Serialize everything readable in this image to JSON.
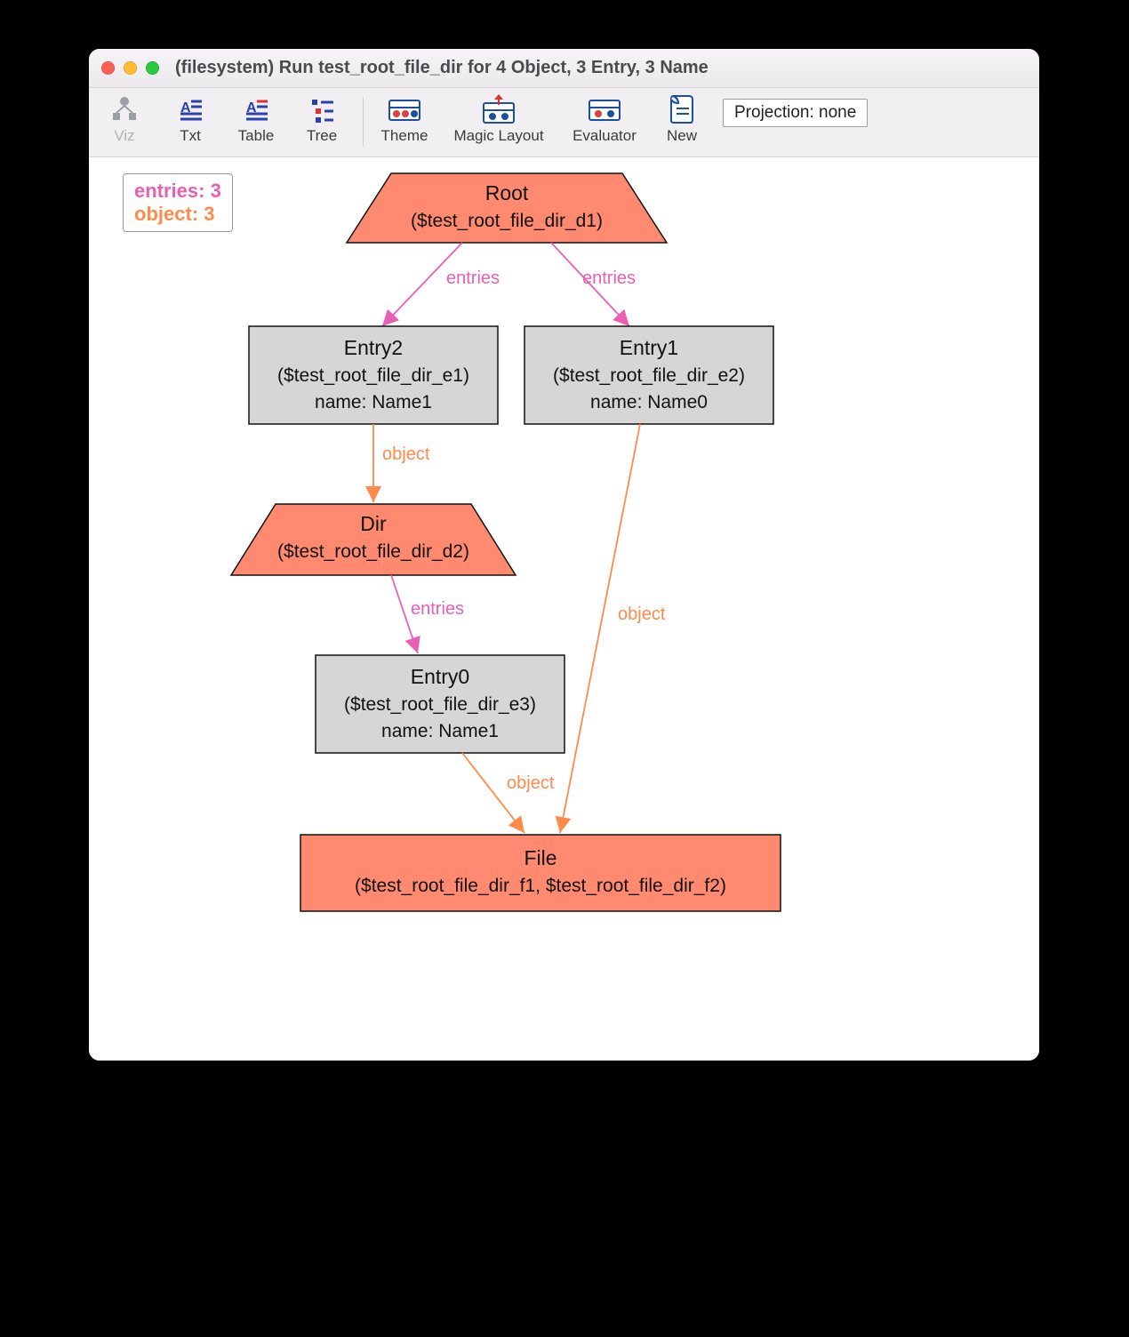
{
  "window": {
    "title": "(filesystem) Run test_root_file_dir for 4 Object, 3 Entry, 3 Name"
  },
  "toolbar": {
    "viz": "Viz",
    "txt": "Txt",
    "table": "Table",
    "tree": "Tree",
    "theme": "Theme",
    "magic": "Magic Layout",
    "eval": "Evaluator",
    "new": "New",
    "projection": "Projection: none"
  },
  "legend": {
    "entries": "entries: 3",
    "object": "object: 3"
  },
  "graph": {
    "nodes": {
      "root": {
        "title": "Root",
        "sub": "($test_root_file_dir_d1)"
      },
      "entry2": {
        "title": "Entry2",
        "sub": "($test_root_file_dir_e1)",
        "attr": "name: Name1"
      },
      "entry1": {
        "title": "Entry1",
        "sub": "($test_root_file_dir_e2)",
        "attr": "name: Name0"
      },
      "dir": {
        "title": "Dir",
        "sub": "($test_root_file_dir_d2)"
      },
      "entry0": {
        "title": "Entry0",
        "sub": "($test_root_file_dir_e3)",
        "attr": "name: Name1"
      },
      "file": {
        "title": "File",
        "sub": "($test_root_file_dir_f1, $test_root_file_dir_f2)"
      }
    },
    "edge_labels": {
      "root_entry2": "entries",
      "root_entry1": "entries",
      "entry2_dir": "object",
      "dir_entry0": "entries",
      "entry0_file": "object",
      "entry1_file": "object"
    }
  }
}
